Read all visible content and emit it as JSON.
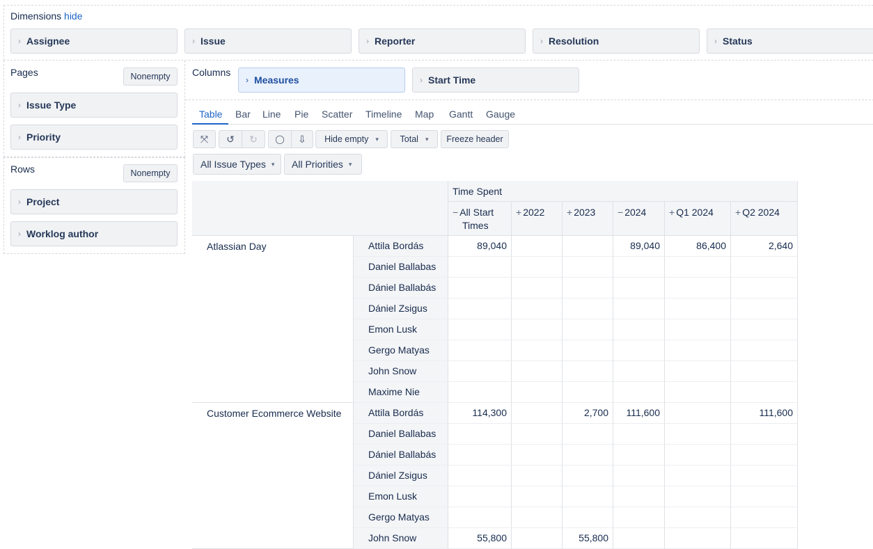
{
  "dimensions": {
    "label": "Dimensions",
    "hide_link": "hide",
    "items": [
      "Assignee",
      "Issue",
      "Reporter",
      "Resolution",
      "Status"
    ]
  },
  "pages": {
    "label": "Pages",
    "nonempty": "Nonempty",
    "items": [
      "Issue Type",
      "Priority"
    ]
  },
  "rows": {
    "label": "Rows",
    "nonempty": "Nonempty",
    "items": [
      "Project",
      "Worklog author"
    ]
  },
  "columns": {
    "label": "Columns",
    "items": [
      "Measures",
      "Start Time"
    ]
  },
  "tabs": [
    "Table",
    "Bar",
    "Line",
    "Pie",
    "Scatter",
    "Timeline",
    "Map",
    "Gantt",
    "Gauge"
  ],
  "active_tab": "Table",
  "toolbar": {
    "hide_empty": "Hide empty",
    "total": "Total",
    "freeze_header": "Freeze header"
  },
  "icons": {
    "chevron": "›",
    "fullscreen": "⤧",
    "undo": "↺",
    "redo": "↻",
    "comment": "💬",
    "export": "⇩",
    "caret": "▾",
    "minus": "−",
    "plus": "+"
  },
  "filters": [
    "All Issue Types",
    "All Priorities"
  ],
  "table": {
    "measure_header": "Time Spent",
    "column_headers": [
      {
        "sign": "−",
        "label": "All Start",
        "label2": "Times"
      },
      {
        "sign": "+",
        "label": "2022",
        "label2": ""
      },
      {
        "sign": "+",
        "label": "2023",
        "label2": ""
      },
      {
        "sign": "−",
        "label": "2024",
        "label2": ""
      },
      {
        "sign": "+",
        "label": "Q1 2024",
        "label2": ""
      },
      {
        "sign": "+",
        "label": "Q2 2024",
        "label2": ""
      }
    ],
    "groups": [
      {
        "project": "Atlassian Day",
        "rows": [
          {
            "author": "Attila Bordás",
            "values": [
              "89,040",
              "",
              "",
              "89,040",
              "86,400",
              "2,640"
            ]
          },
          {
            "author": "Daniel Ballabas",
            "values": [
              "",
              "",
              "",
              "",
              "",
              ""
            ]
          },
          {
            "author": "Dániel Ballabás",
            "values": [
              "",
              "",
              "",
              "",
              "",
              ""
            ]
          },
          {
            "author": "Dániel Zsigus",
            "values": [
              "",
              "",
              "",
              "",
              "",
              ""
            ]
          },
          {
            "author": "Emon Lusk",
            "values": [
              "",
              "",
              "",
              "",
              "",
              ""
            ]
          },
          {
            "author": "Gergo Matyas",
            "values": [
              "",
              "",
              "",
              "",
              "",
              ""
            ]
          },
          {
            "author": "John Snow",
            "values": [
              "",
              "",
              "",
              "",
              "",
              ""
            ]
          },
          {
            "author": "Maxime Nie",
            "values": [
              "",
              "",
              "",
              "",
              "",
              ""
            ]
          }
        ]
      },
      {
        "project": "Customer Ecommerce Website",
        "rows": [
          {
            "author": "Attila Bordás",
            "values": [
              "114,300",
              "",
              "2,700",
              "111,600",
              "",
              "111,600"
            ]
          },
          {
            "author": "Daniel Ballabas",
            "values": [
              "",
              "",
              "",
              "",
              "",
              ""
            ]
          },
          {
            "author": "Dániel Ballabás",
            "values": [
              "",
              "",
              "",
              "",
              "",
              ""
            ]
          },
          {
            "author": "Dániel Zsigus",
            "values": [
              "",
              "",
              "",
              "",
              "",
              ""
            ]
          },
          {
            "author": "Emon Lusk",
            "values": [
              "",
              "",
              "",
              "",
              "",
              ""
            ]
          },
          {
            "author": "Gergo Matyas",
            "values": [
              "",
              "",
              "",
              "",
              "",
              ""
            ]
          },
          {
            "author": "John Snow",
            "values": [
              "55,800",
              "",
              "55,800",
              "",
              "",
              ""
            ]
          }
        ]
      }
    ]
  }
}
